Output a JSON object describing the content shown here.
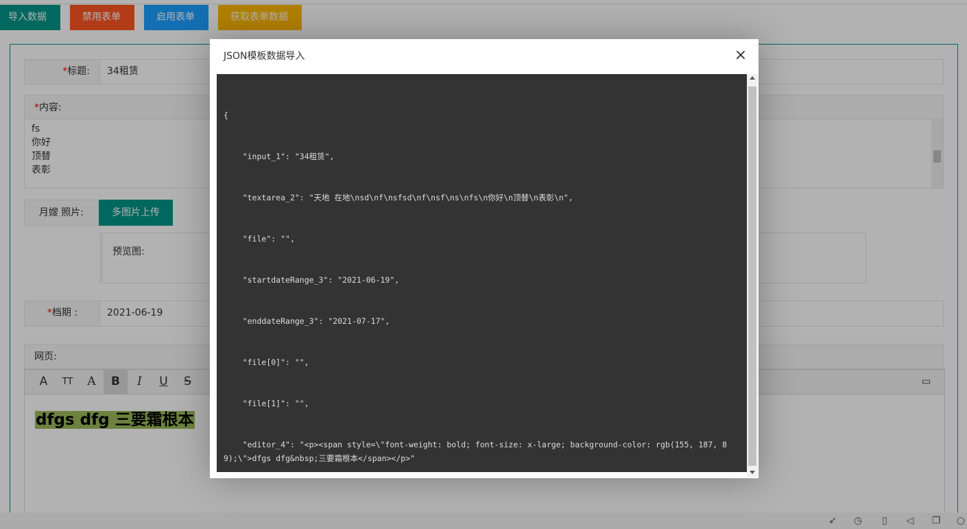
{
  "toolbar": {
    "import": "导入数据",
    "disable": "禁用表单",
    "enable": "启用表单",
    "get": "获取表单数据"
  },
  "form": {
    "title_label": "标题:",
    "title_value": "34租赁",
    "content_label": "内容:",
    "content_lines": [
      "fs",
      "你好",
      "顶替",
      "表彰"
    ],
    "photo_label": "月嫂 照片:",
    "upload_button": "多图片上传",
    "preview_label": "预览图:",
    "date_label": "档期 :",
    "date_value": "2021-06-19",
    "web_label": "网页:",
    "required_mark": "*",
    "editor_text": "dfgs dfg 三要霜根本"
  },
  "editor_tools": [
    "A",
    "TT",
    "A",
    "B",
    "I",
    "U",
    "S"
  ],
  "modal": {
    "title": "JSON模板数据导入",
    "close": "×",
    "code_lines": [
      "{",
      "    \"input_1\": \"34租赁\",",
      "    \"textarea_2\": \"天地 在地\\nsd\\nf\\nsfsd\\nf\\nsf\\ns\\nfs\\n你好\\n顶替\\n表彰\\n\",",
      "    \"file\": \"\",",
      "    \"startdateRange_3\": \"2021-06-19\",",
      "    \"enddateRange_3\": \"2021-07-17\",",
      "    \"file[0]\": \"\",",
      "    \"file[1]\": \"\",",
      "    \"editor_4\": \"<p><span style=\\\"font-weight: bold; font-size: x-large; background-color: rgb(155, 187, 89);\\\">dfgs dfg&nbsp;三要霜根本</span></p>\"",
      "}"
    ]
  },
  "colors": {
    "primary": "#009688",
    "danger": "#ff5722",
    "normal": "#1e9fff",
    "warm": "#ffb800",
    "highlight": "#9bbb59"
  }
}
